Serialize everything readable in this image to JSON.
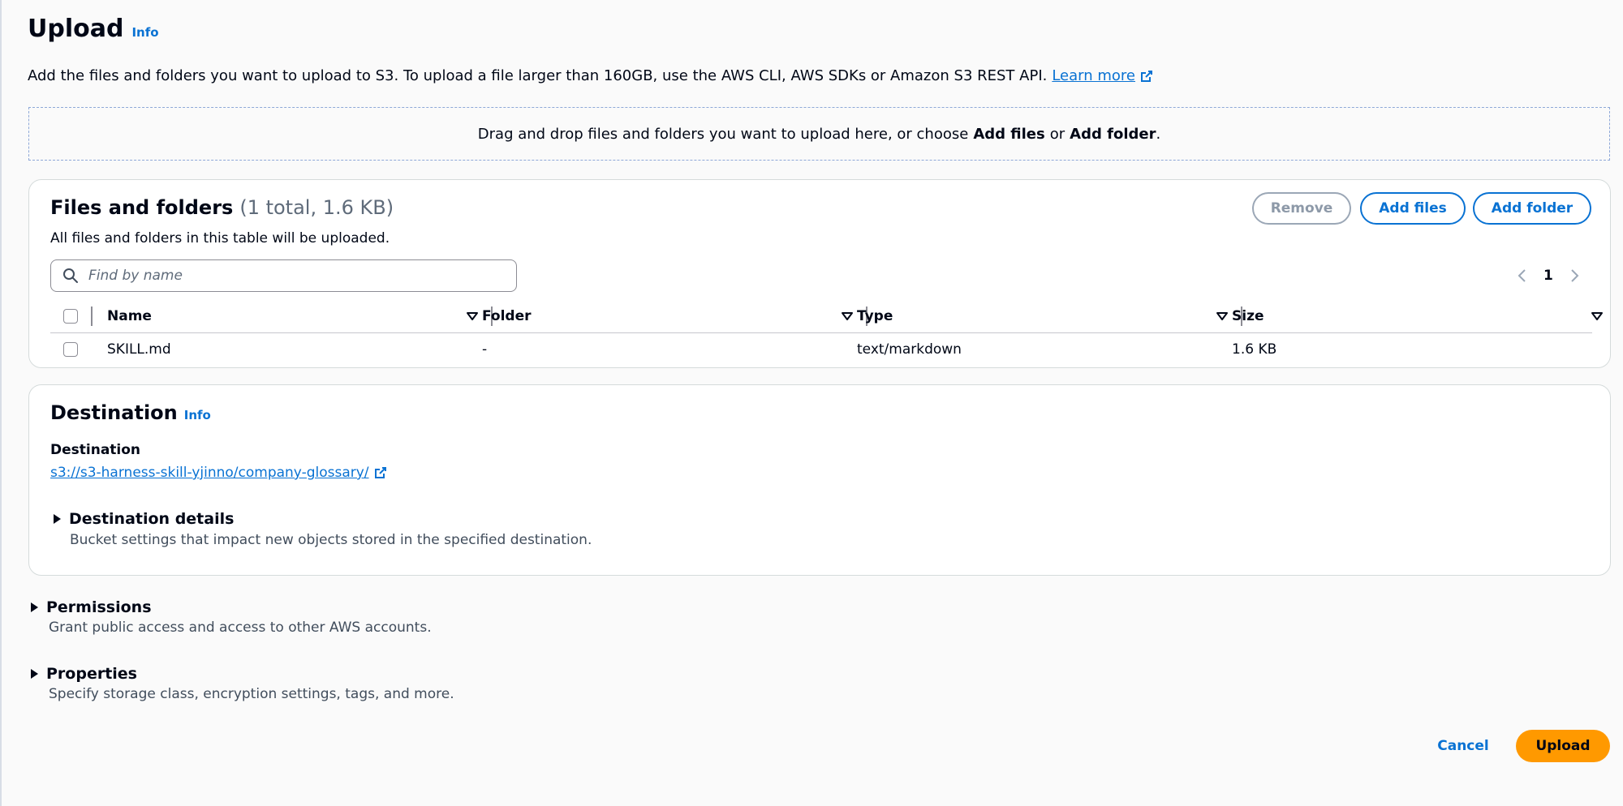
{
  "header": {
    "title": "Upload",
    "info_label": "Info"
  },
  "intro": {
    "text": "Add the files and folders you want to upload to S3. To upload a file larger than 160GB, use the AWS CLI, AWS SDKs or Amazon S3 REST API.",
    "learn_more_label": "Learn more"
  },
  "dropzone": {
    "text_before": "Drag and drop files and folders you want to upload here, or choose",
    "add_files": "Add files",
    "or": "or",
    "add_folder": "Add folder",
    "period": "."
  },
  "files_panel": {
    "title": "Files and folders",
    "count": "(1 total, 1.6 KB)",
    "description": "All files and folders in this table will be uploaded.",
    "remove_label": "Remove",
    "add_files_label": "Add files",
    "add_folder_label": "Add folder",
    "search_placeholder": "Find by name",
    "current_page": "1",
    "columns": [
      "Name",
      "Folder",
      "Type",
      "Size"
    ],
    "rows": [
      {
        "name": "SKILL.md",
        "folder": "-",
        "type": "text/markdown",
        "size": "1.6 KB"
      }
    ]
  },
  "destination_panel": {
    "title": "Destination",
    "info_label": "Info",
    "field_label": "Destination",
    "uri": "s3://s3-harness-skill-yjinno/company-glossary/",
    "details_label": "Destination details",
    "details_desc": "Bucket settings that impact new objects stored in the specified destination."
  },
  "permissions": {
    "label": "Permissions",
    "desc": "Grant public access and access to other AWS accounts."
  },
  "properties": {
    "label": "Properties",
    "desc": "Specify storage class, encryption settings, tags, and more."
  },
  "footer": {
    "cancel_label": "Cancel",
    "upload_label": "Upload"
  },
  "colors": {
    "accent": "#0972d3",
    "primary_button": "#ff9900",
    "text": "#000716"
  }
}
